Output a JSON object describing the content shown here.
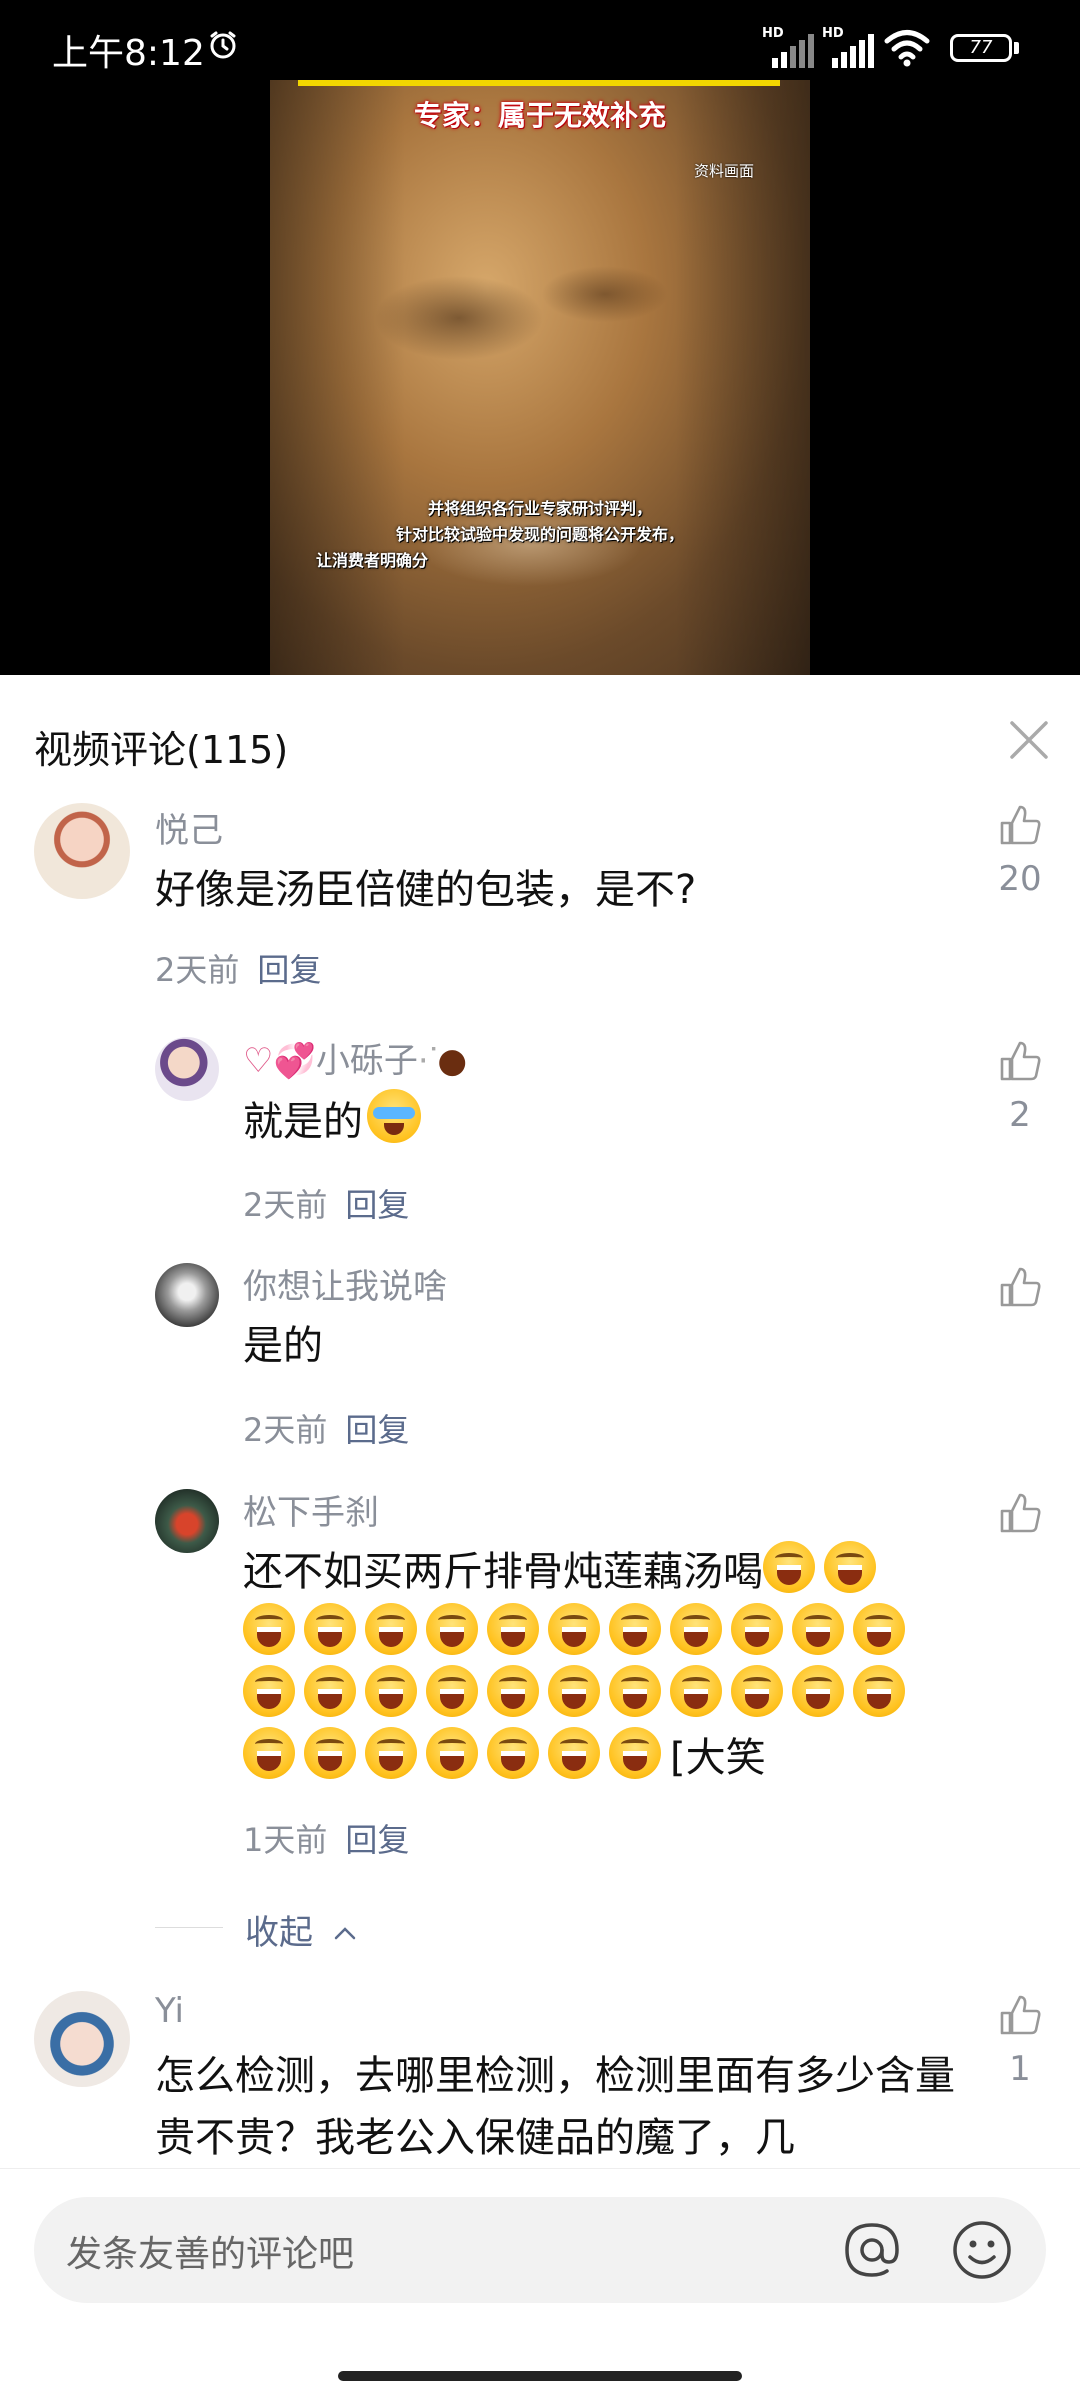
{
  "status_bar": {
    "time": "上午8:12",
    "battery": "77"
  },
  "video": {
    "title": "专家：属于无效补充",
    "source": "资料画面",
    "subtitles": [
      "并将组织各行业专家研讨评判，",
      "针对比较试验中发现的问题将公开发布，",
      "让消费者明确分"
    ]
  },
  "panel": {
    "title": "视频评论(115)"
  },
  "comments": [
    {
      "user": "悦己",
      "text": "好像是汤臣倍健的包装，是不?",
      "time": "2天前",
      "reply": "回复",
      "likes": "20"
    },
    {
      "user": "小砾子",
      "text": "就是的",
      "time": "2天前",
      "reply": "回复",
      "likes": "2"
    },
    {
      "user": "你想让我说啥",
      "text": "是的",
      "time": "2天前",
      "reply": "回复",
      "likes": ""
    },
    {
      "user": "松下手刹",
      "text": "还不如买两斤排骨炖莲藕汤喝",
      "text_tail": "[大笑",
      "time": "1天前",
      "reply": "回复",
      "likes": ""
    },
    {
      "user": "Yi",
      "text": "怎么检测，去哪里检测，检测里面有多少含量贵不贵？我老公入保健品的魔了，几",
      "time": "",
      "reply": "",
      "likes": "1"
    }
  ],
  "collapse_label": "收起",
  "input": {
    "placeholder": "发条友善的评论吧"
  },
  "icons": {
    "alarm": "alarm-clock-icon",
    "signal": "signal-icon",
    "wifi": "wifi-icon",
    "battery": "battery-icon",
    "close": "close-icon",
    "like": "thumbs-up-icon",
    "chevron": "chevron-up-icon",
    "at": "at-sign-icon",
    "smile": "smiley-face-icon",
    "emoji_laugh": "laughing-emoji-icon",
    "emoji_cry": "crying-laughing-emoji-icon"
  }
}
